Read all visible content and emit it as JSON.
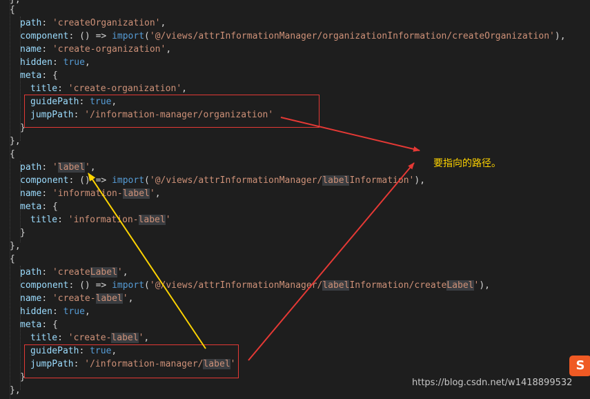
{
  "annotation": "要指向的路径。",
  "watermark": "https://blog.csdn.net/w1418899532",
  "logo_text": "S",
  "code": {
    "close_brace_top": "},",
    "open1": "{",
    "path1_key": "path",
    "path1_val": "'createOrganization'",
    "comp1_key": "component",
    "comp1_fn": "() => ",
    "comp1_import": "import",
    "comp1_arg": "'@/views/attrInformationManager/organizationInformation/createOrganization'",
    "name1_key": "name",
    "name1_val": "'create-organization'",
    "hidden1_key": "hidden",
    "hidden1_val": "true",
    "meta1_key": "meta",
    "title1_key": "title",
    "title1_val": "'create-organization'",
    "guide1_key": "guidePath",
    "guide1_val": "true",
    "jump1_key": "jumpPath",
    "jump1_val": "'/information-manager/organization'",
    "close_meta1": "}",
    "close_obj1": "},",
    "open2": "{",
    "path2_key": "path",
    "path2_q1": "'",
    "path2_hl": "label",
    "path2_q2": "'",
    "comp2_key": "component",
    "comp2_fn": "() => ",
    "comp2_import": "import",
    "comp2_a": "'@/views/attrInformationManager/",
    "comp2_hl": "label",
    "comp2_b": "Information'",
    "name2_key": "name",
    "name2_a": "'information-",
    "name2_hl": "label",
    "name2_b": "'",
    "meta2_key": "meta",
    "title2_key": "title",
    "title2_a": "'information-",
    "title2_hl": "label",
    "title2_b": "'",
    "close_meta2": "}",
    "close_obj2": "},",
    "open3": "{",
    "path3_key": "path",
    "path3_a": "'create",
    "path3_hl": "Label",
    "path3_b": "'",
    "comp3_key": "component",
    "comp3_fn": "() => ",
    "comp3_import": "import",
    "comp3_a": "'@/views/attrInformationManager/",
    "comp3_hl": "label",
    "comp3_b": "Information/create",
    "comp3_hl2": "Label",
    "comp3_c": "'",
    "name3_key": "name",
    "name3_a": "'create-",
    "name3_hl": "label",
    "name3_b": "'",
    "hidden3_key": "hidden",
    "hidden3_val": "true",
    "meta3_key": "meta",
    "title3_key": "title",
    "title3_a": "'create-",
    "title3_hl": "label",
    "title3_b": "'",
    "guide3_key": "guidePath",
    "guide3_val": "true",
    "jump3_key": "jumpPath",
    "jump3_a": "'/information-manager/",
    "jump3_hl": "label",
    "jump3_b": "'",
    "close_meta3": "}",
    "close_obj3": "},"
  },
  "colors": {
    "background": "#1e1e1e",
    "property": "#9cdcfe",
    "string": "#ce9178",
    "keyword": "#569cd6",
    "red_annotation": "#e53935",
    "yellow_annotation": "#ffd400"
  }
}
